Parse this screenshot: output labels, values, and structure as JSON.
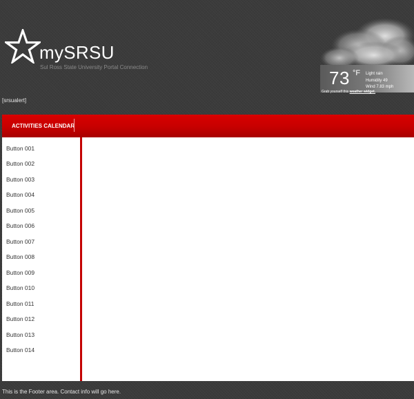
{
  "header": {
    "logo_text": "mySRSU",
    "tagline": "Sul Ross State University Portal Connection",
    "alert_text": "[srsualert]"
  },
  "weather": {
    "temperature": "73",
    "unit": "°F",
    "condition": "Light rain",
    "humidity": "Humidity 49",
    "wind": "Wind 7.83 mph",
    "credit_prefix": "Grab yourself this",
    "credit_link": "weather widget.",
    "icon": "cloud-icon"
  },
  "nav": {
    "items": [
      {
        "label": "ACTIVITIES CALENDAR"
      }
    ]
  },
  "sidebar": {
    "items": [
      {
        "label": "Button 001"
      },
      {
        "label": "Button 002"
      },
      {
        "label": "Button 003"
      },
      {
        "label": "Button 004"
      },
      {
        "label": "Button 005"
      },
      {
        "label": "Button 006"
      },
      {
        "label": "Button 007"
      },
      {
        "label": "Button 008"
      },
      {
        "label": "Button 009"
      },
      {
        "label": "Button 010"
      },
      {
        "label": "Button 011"
      },
      {
        "label": "Button 012"
      },
      {
        "label": "Button 013"
      },
      {
        "label": "Button 014"
      }
    ]
  },
  "footer": {
    "text": "This is the Footer area. Contact info will go here."
  },
  "colors": {
    "background": "#3b3b3b",
    "accent_red": "#c60000",
    "content_bg": "#ffffff",
    "text_light": "#e6e6e6"
  }
}
